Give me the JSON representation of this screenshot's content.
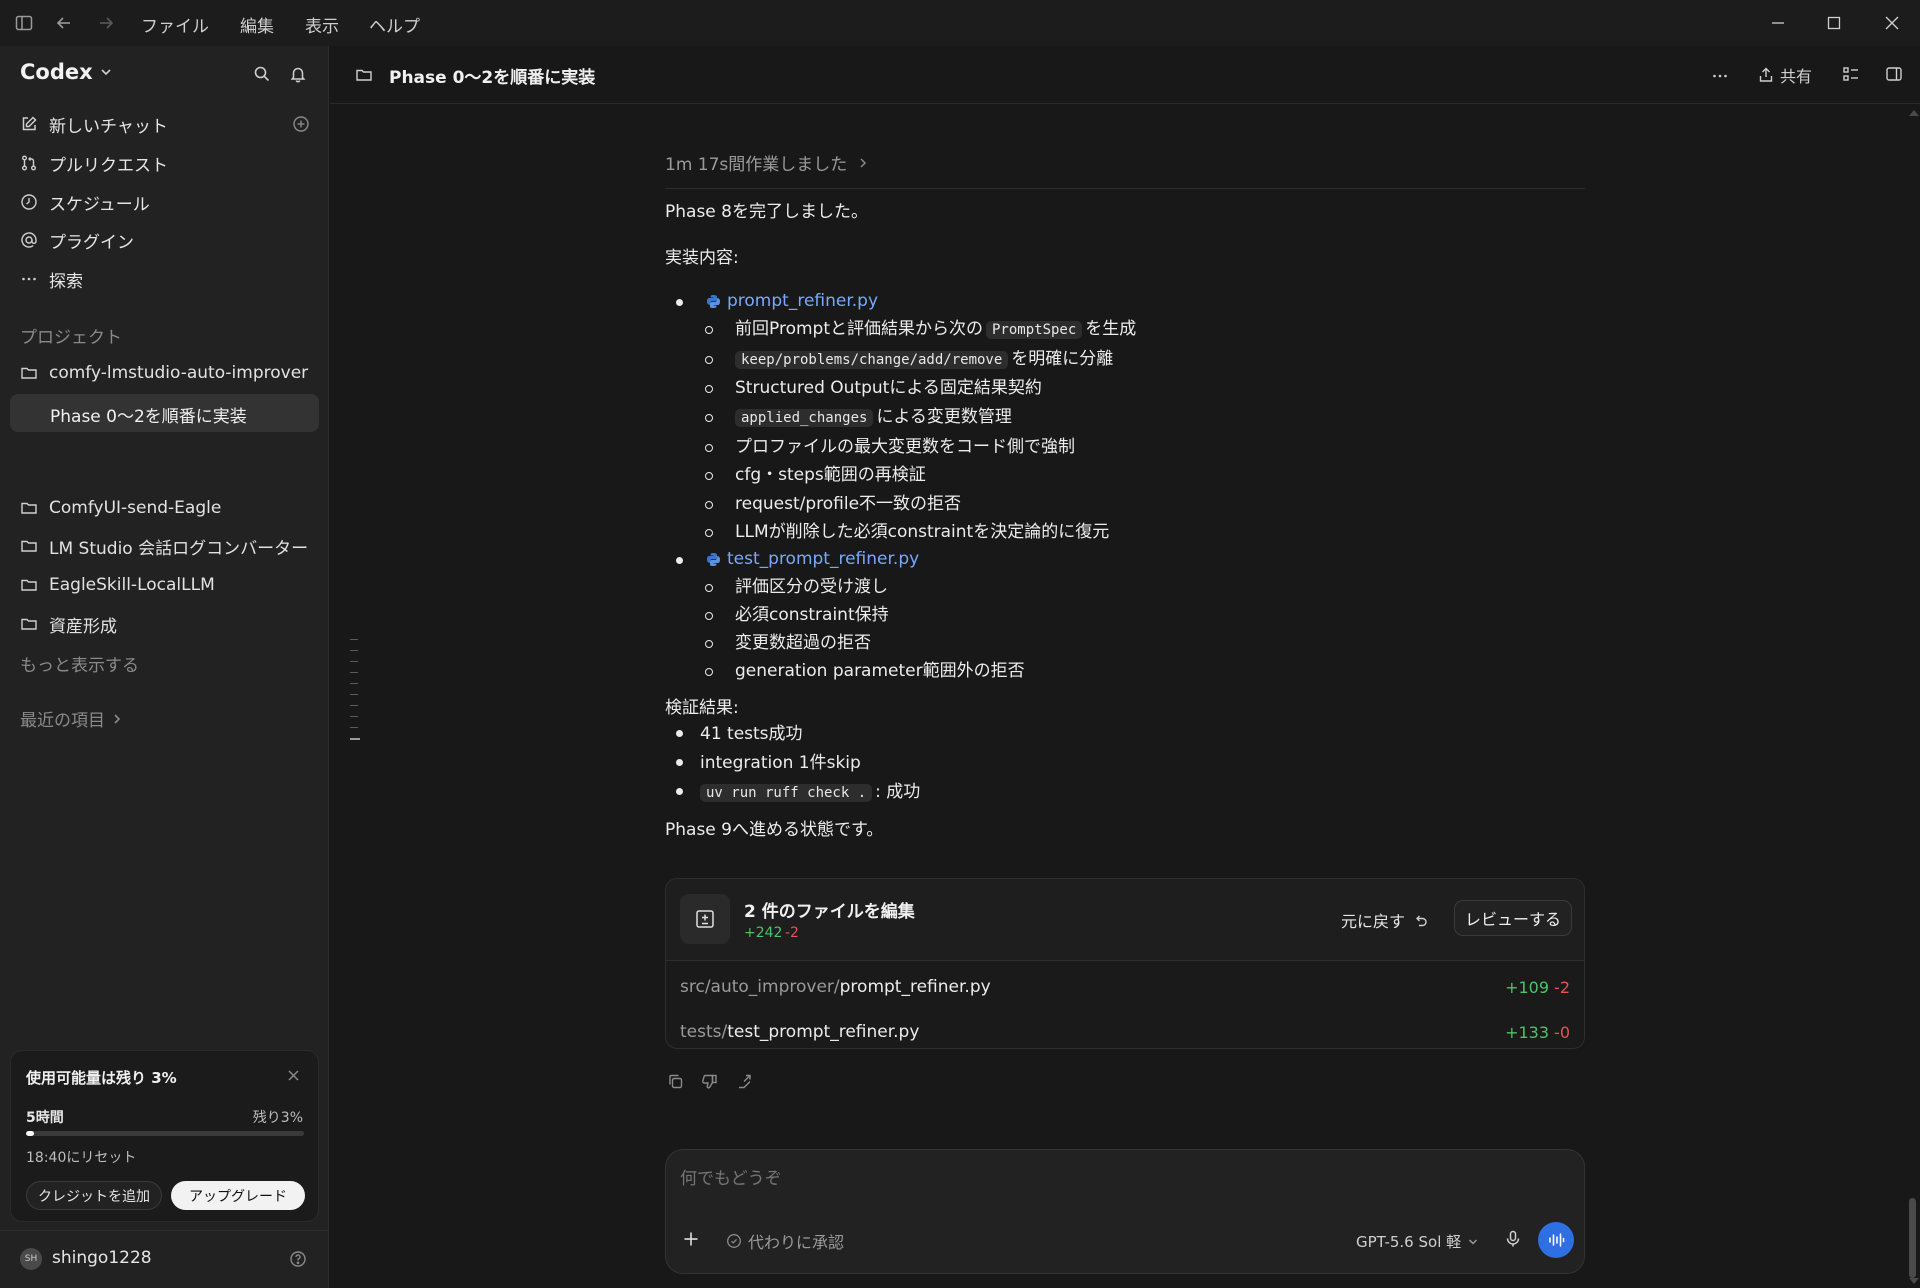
{
  "menubar": {
    "items": [
      "ファイル",
      "編集",
      "表示",
      "ヘルプ"
    ]
  },
  "sidebar": {
    "app_name": "Codex",
    "nav": [
      {
        "label": "新しいチャット",
        "icon": "edit-icon"
      },
      {
        "label": "プルリクエスト",
        "icon": "pull-request-icon"
      },
      {
        "label": "スケジュール",
        "icon": "clock-icon"
      },
      {
        "label": "プラグイン",
        "icon": "at-icon"
      },
      {
        "label": "探索",
        "icon": "more-icon"
      }
    ],
    "projects_heading": "プロジェクト",
    "projects": [
      {
        "label": "comfy-lmstudio-auto-improver"
      },
      {
        "label": "Phase 0〜2を順番に実装"
      },
      {
        "label": "ComfyUI-send-Eagle"
      },
      {
        "label": "LM Studio 会話ログコンバーター"
      },
      {
        "label": "EagleSkill-LocalLLM"
      },
      {
        "label": "資産形成"
      }
    ],
    "show_more": "もっと表示する",
    "recent": "最近の項目",
    "usage": {
      "title": "使用可能量は残り 3%",
      "period": "5時間",
      "remaining": "残り3%",
      "remaining_fraction": 0.03,
      "reset": "18:40にリセット",
      "add_credit": "クレジットを追加",
      "upgrade": "アップグレード"
    },
    "user": {
      "initials": "SH",
      "name": "shingo1228"
    }
  },
  "header": {
    "title": "Phase 0〜2を順番に実装",
    "share": "共有"
  },
  "chat": {
    "worked": "1m 17s間作業しました",
    "completed": "Phase 8を完了しました。",
    "impl_heading": "実装内容:",
    "file1": "prompt_refiner.py",
    "file1_items": {
      "i1a": "前回Promptと評価結果から次の",
      "i1b": "PromptSpec",
      "i1c": "を生成",
      "i2a": "keep/problems/change/add/remove",
      "i2b": "を明確に分離",
      "i3": "Structured Outputによる固定結果契約",
      "i4a": "applied_changes",
      "i4b": "による変更数管理",
      "i5": "プロファイルの最大変更数をコード側で強制",
      "i6": "cfg・steps範囲の再検証",
      "i7": "request/profile不一致の拒否",
      "i8": "LLMが削除した必須constraintを決定論的に復元"
    },
    "file2": "test_prompt_refiner.py",
    "file2_items": [
      "評価区分の受け渡し",
      "必須constraint保持",
      "変更数超過の拒否",
      "generation parameter範囲外の拒否"
    ],
    "verify_heading": "検証結果:",
    "verify": {
      "v1": "41 tests成功",
      "v2": "integration 1件skip",
      "v3a": "uv run ruff check .",
      "v3b": ": 成功"
    },
    "next": "Phase 9へ進める状態です。",
    "edits": {
      "title": "2 件のファイルを編集",
      "added": "+242",
      "removed": "-2",
      "undo": "元に戻す",
      "review": "レビューする",
      "files": [
        {
          "dir": "src/auto_improver/",
          "name": "prompt_refiner.py",
          "added": "+109",
          "removed": "-2"
        },
        {
          "dir": "tests/",
          "name": "test_prompt_refiner.py",
          "added": "+133",
          "removed": "-0"
        }
      ]
    }
  },
  "composer": {
    "placeholder": "何でもどうぞ",
    "approve": "代わりに承認",
    "model": "GPT-5.6 Sol 軽"
  },
  "colors": {
    "accent": "#2f6fe4",
    "link": "#7aa8ff",
    "added": "#4cc36b",
    "removed": "#e55353"
  }
}
